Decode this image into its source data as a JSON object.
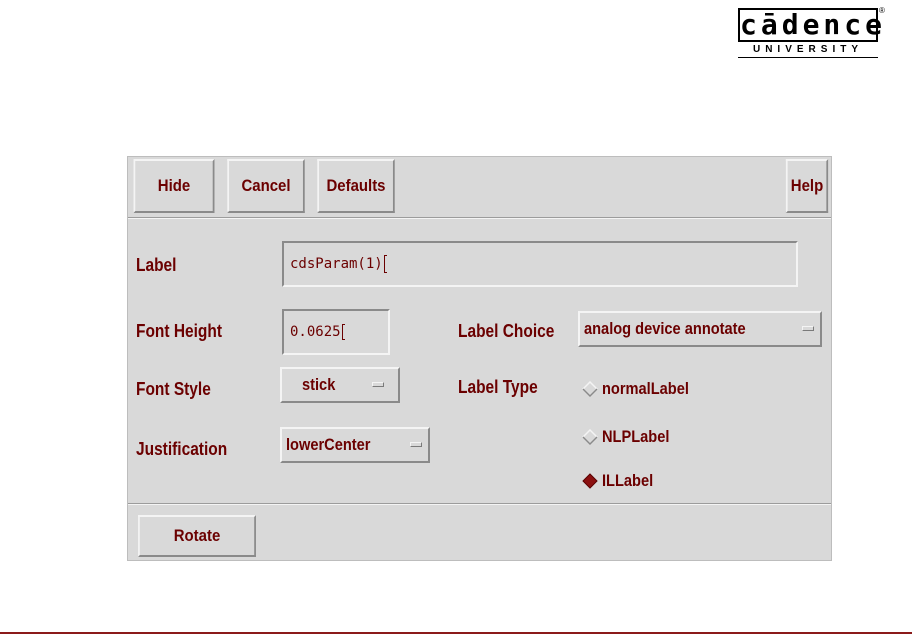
{
  "logo": {
    "wordmark": "cādence",
    "registered": "®",
    "subtitle": "UNIVERSITY"
  },
  "toolbar": {
    "hide": "Hide",
    "cancel": "Cancel",
    "defaults": "Defaults",
    "help": "Help"
  },
  "form": {
    "label": {
      "caption": "Label",
      "value": "cdsParam(1)"
    },
    "font_height": {
      "caption": "Font Height",
      "value": "0.0625"
    },
    "font_style": {
      "caption": "Font Style",
      "selected": "stick"
    },
    "justification": {
      "caption": "Justification",
      "selected": "lowerCenter"
    },
    "label_choice": {
      "caption": "Label Choice",
      "selected": "analog device annotate"
    },
    "label_type": {
      "caption": "Label Type",
      "options": [
        "normalLabel",
        "NLPLabel",
        "ILLabel"
      ],
      "selected": "ILLabel"
    }
  },
  "bottom": {
    "rotate": "Rotate"
  },
  "colors": {
    "text": "#6b0000",
    "panel": "#d9d9d9",
    "rule": "#8b1a1a"
  }
}
